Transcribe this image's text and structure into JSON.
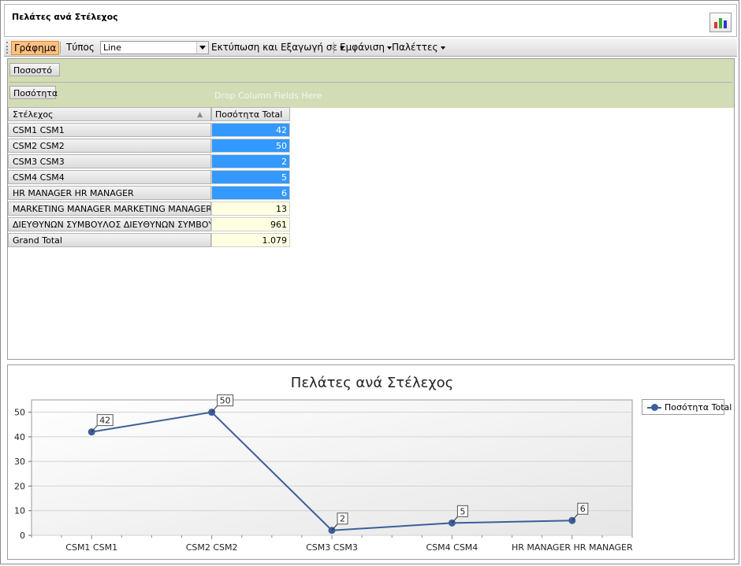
{
  "window": {
    "title": "Πελάτες ανά Στέλεχος"
  },
  "toolbar": {
    "chart_label": "Γράφημα",
    "type_label": "Τύπος",
    "type_value": "Line",
    "print_export_label": "Εκτύπωση και Εξαγωγή σε",
    "appearance_label": "Εμφάνιση",
    "palettes_label": "Παλέττες"
  },
  "pivot": {
    "filter_field": "Ποσοστό",
    "data_field": "Ποσότητα",
    "drop_hint": "Drop Column Fields Here",
    "row_field": "Στέλεχος",
    "total_header": "Ποσότητα Total",
    "rows": [
      {
        "label": "CSM1 CSM1",
        "value": "42"
      },
      {
        "label": "CSM2 CSM2",
        "value": "50"
      },
      {
        "label": "CSM3 CSM3",
        "value": "2"
      },
      {
        "label": "CSM4 CSM4",
        "value": "5"
      },
      {
        "label": "HR MANAGER HR MANAGER",
        "value": "6"
      },
      {
        "label": "MARKETING MANAGER MARKETING MANAGER",
        "value": "13"
      },
      {
        "label": "ΔΙΕΥΘΥΝΩΝ ΣΥΜΒΟΥΛΟΣ ΔΙΕΥΘΥΝΩΝ ΣΥΜΒΟΥΛΟΣ",
        "value": "961"
      },
      {
        "label": "Grand Total",
        "value": "1.079"
      }
    ]
  },
  "chart_data": {
    "type": "line",
    "title": "Πελάτες ανά Στέλεχος",
    "categories": [
      "CSM1 CSM1",
      "CSM2 CSM2",
      "CSM3 CSM3",
      "CSM4 CSM4",
      "HR MANAGER HR MANAGER"
    ],
    "series": [
      {
        "name": "Ποσότητα Total",
        "values": [
          42,
          50,
          2,
          5,
          6
        ]
      }
    ],
    "ylim": [
      0,
      55
    ],
    "yticks": [
      0,
      10,
      20,
      30,
      40,
      50
    ],
    "legend": "top-right",
    "grid": true,
    "line_color": "#3a5f99"
  }
}
